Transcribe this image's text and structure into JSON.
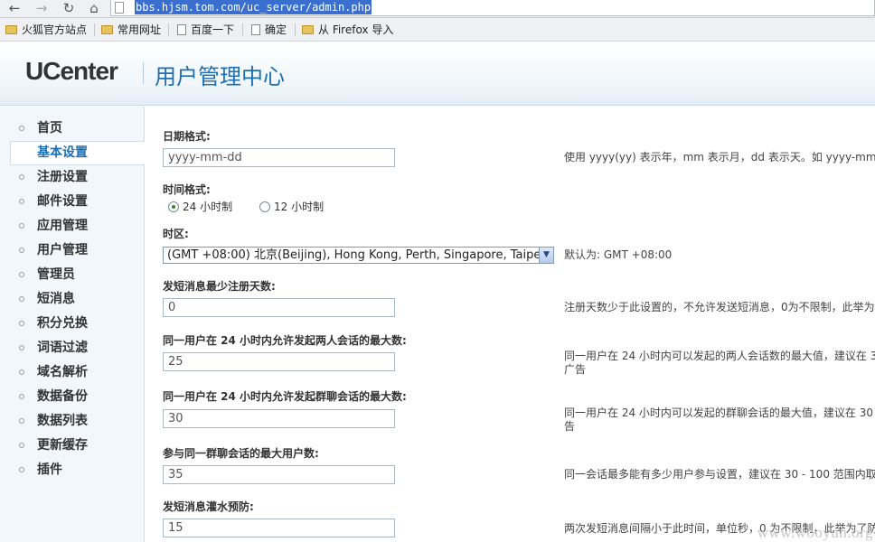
{
  "browser": {
    "url": "bbs.hjsm.tom.com/uc_server/admin.php",
    "back_glyph": "←",
    "forward_glyph": "→",
    "reload_glyph": "↻",
    "home_glyph": "⌂",
    "bookmarks": [
      {
        "label": "火狐官方站点",
        "icon": "folder-icon"
      },
      {
        "label": "常用网址",
        "icon": "folder-icon"
      },
      {
        "label": "百度一下",
        "icon": "page-icon"
      },
      {
        "label": "确定",
        "icon": "page-icon"
      },
      {
        "label": "从 Firefox 导入",
        "icon": "folder-icon"
      }
    ]
  },
  "header": {
    "logo": "UCenter",
    "title": "用户管理中心"
  },
  "sidebar": {
    "items": [
      {
        "label": "首页",
        "active": false
      },
      {
        "label": "基本设置",
        "active": true
      },
      {
        "label": "注册设置",
        "active": false
      },
      {
        "label": "邮件设置",
        "active": false
      },
      {
        "label": "应用管理",
        "active": false
      },
      {
        "label": "用户管理",
        "active": false
      },
      {
        "label": "管理员",
        "active": false
      },
      {
        "label": "短消息",
        "active": false
      },
      {
        "label": "积分兑换",
        "active": false
      },
      {
        "label": "词语过滤",
        "active": false
      },
      {
        "label": "域名解析",
        "active": false
      },
      {
        "label": "数据备份",
        "active": false
      },
      {
        "label": "数据列表",
        "active": false
      },
      {
        "label": "更新缓存",
        "active": false
      },
      {
        "label": "插件",
        "active": false
      }
    ]
  },
  "form": {
    "date_format": {
      "label": "日期格式:",
      "value": "yyyy-mm-dd",
      "help": "使用 yyyy(yy) 表示年，mm 表示月，dd 表示天。如 yyyy-mm"
    },
    "time_format": {
      "label": "时间格式:",
      "option_24": "24 小时制",
      "option_12": "12 小时制",
      "selected": "24"
    },
    "timezone": {
      "label": "时区:",
      "value": "(GMT +08:00) 北京(Beijing), Hong Kong, Perth, Singapore, Taipei",
      "help": "默认为: GMT +08:00"
    },
    "pm_min_reg_days": {
      "label": "发短消息最少注册天数:",
      "value": "0",
      "help": "注册天数少于此设置的，不允许发送短消息，0为不限制，此举为"
    },
    "max_private_sessions": {
      "label": "同一用户在 24 小时内允许发起两人会话的最大数:",
      "value": "25",
      "help_line1": "同一用户在 24 小时内可以发起的两人会话数的最大值，建议在 3",
      "help_line2": "广告"
    },
    "max_group_sessions": {
      "label": "同一用户在 24 小时内允许发起群聊会话的最大数:",
      "value": "30",
      "help_line1": "同一用户在 24 小时内可以发起的群聊会话的最大值，建议在 30",
      "help_line2": "告"
    },
    "max_group_members": {
      "label": "参与同一群聊会话的最大用户数:",
      "value": "35",
      "help": "同一会话最多能有多少用户参与设置，建议在 30 - 100 范围内取"
    },
    "pm_flood": {
      "label": "发短消息灌水预防:",
      "value": "15",
      "help": "两次发短消息间隔小于此时间，单位秒，0 为不限制，此举为了防"
    }
  },
  "watermark": "www.wooyun.org"
}
